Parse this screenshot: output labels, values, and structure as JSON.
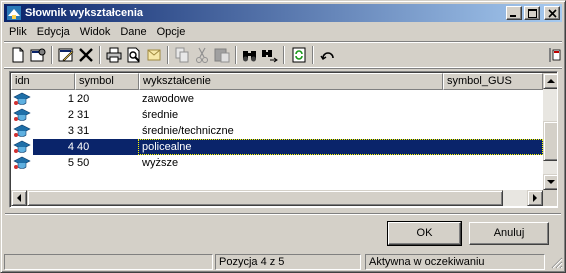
{
  "window": {
    "title": "Słownik wykształcenia"
  },
  "menu": [
    "Plik",
    "Edycja",
    "Widok",
    "Dane",
    "Opcje"
  ],
  "toolbar": {
    "icons": [
      "new-icon",
      "properties-icon",
      "edit-icon",
      "delete-icon",
      "print-icon",
      "print-preview-icon",
      "send-icon",
      "copy-icon",
      "cut-icon",
      "paste-icon",
      "find-icon",
      "find-next-icon",
      "refresh-icon",
      "undo-icon"
    ]
  },
  "grid": {
    "columns": [
      "idn",
      "symbol",
      "wykształcenie",
      "symbol_GUS"
    ],
    "rows": [
      {
        "idn": "1",
        "symbol": "20",
        "wyksztalcenie": "zawodowe",
        "symbol_gus": ""
      },
      {
        "idn": "2",
        "symbol": "31",
        "wyksztalcenie": "średnie",
        "symbol_gus": ""
      },
      {
        "idn": "3",
        "symbol": "31",
        "wyksztalcenie": "średnie/techniczne",
        "symbol_gus": ""
      },
      {
        "idn": "4",
        "symbol": "40",
        "wyksztalcenie": "policealne",
        "symbol_gus": ""
      },
      {
        "idn": "5",
        "symbol": "50",
        "wyksztalcenie": "wyższe",
        "symbol_gus": ""
      }
    ],
    "selected_index": 3
  },
  "buttons": {
    "ok": "OK",
    "cancel": "Anuluj"
  },
  "status": {
    "position": "Pozycja 4 z 5",
    "state": "Aktywna w oczekiwaniu"
  },
  "colors": {
    "titlebar_start": "#0a246a",
    "titlebar_end": "#a6caf0",
    "selection": "#0a246a",
    "face": "#d4d0c8"
  }
}
